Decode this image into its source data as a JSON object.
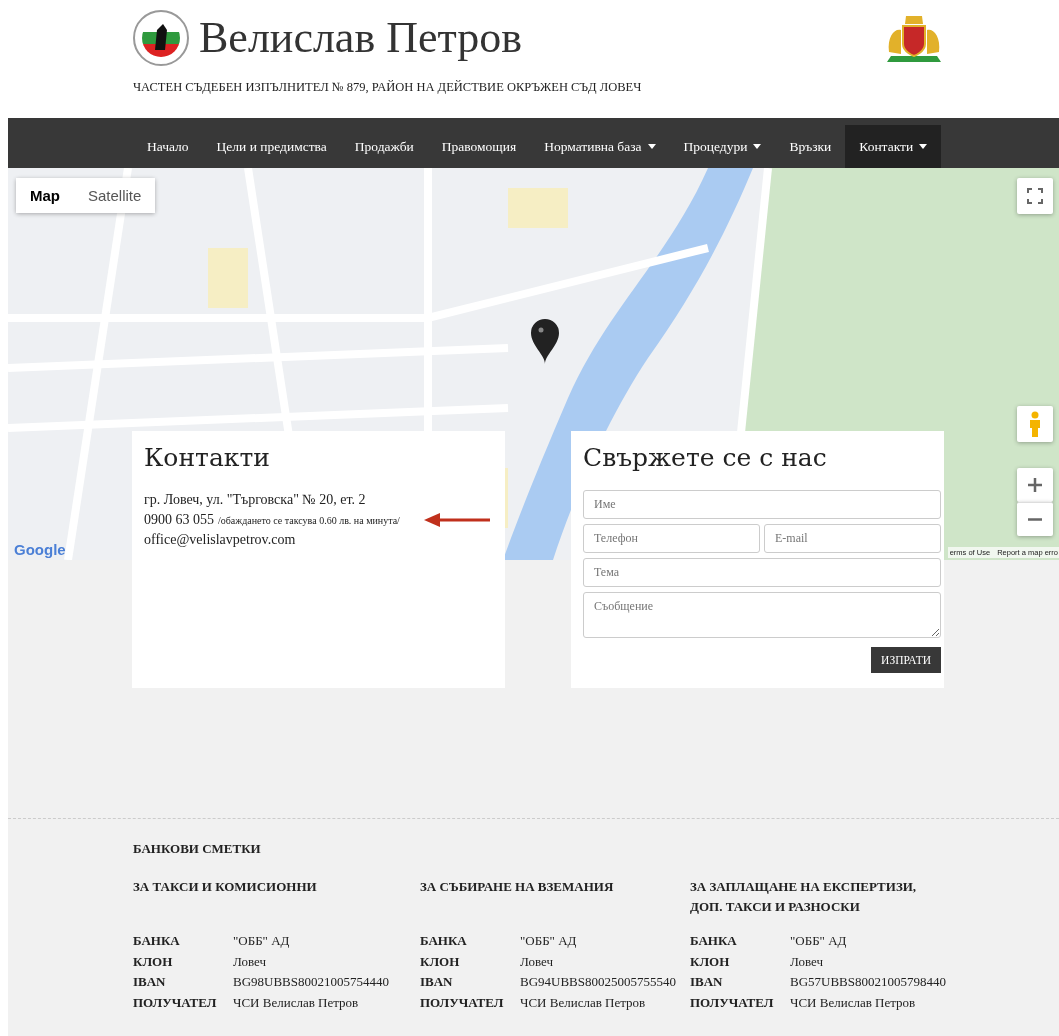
{
  "header": {
    "name": "Велислав Петров",
    "subtitle": "ЧАСТЕН СЪДЕБЕН ИЗПЪЛНИТЕЛ № 879, РАЙОН НА ДЕЙСТВИЕ ОКРЪЖЕН СЪД ЛОВЕЧ"
  },
  "nav": {
    "items": [
      {
        "label": "Начало",
        "selected": false,
        "dropdown": false
      },
      {
        "label": "Цели и предимства",
        "selected": false,
        "dropdown": false
      },
      {
        "label": "Продажби",
        "selected": false,
        "dropdown": false
      },
      {
        "label": "Правомощия",
        "selected": false,
        "dropdown": false
      },
      {
        "label": "Нормативна база",
        "selected": false,
        "dropdown": true
      },
      {
        "label": "Процедури",
        "selected": false,
        "dropdown": true
      },
      {
        "label": "Връзки",
        "selected": false,
        "dropdown": false
      },
      {
        "label": "Контакти",
        "selected": true,
        "dropdown": true
      }
    ]
  },
  "map": {
    "view_tabs": [
      {
        "label": "Map",
        "selected": true
      },
      {
        "label": "Satellite",
        "selected": false
      }
    ],
    "attribution": "Google",
    "links": [
      "erms of Use",
      "Report a map erro"
    ]
  },
  "contacts": {
    "title": "Контакти",
    "address": "гр. Ловеч, ул. \"Търговска\" № 20, ет. 2",
    "phone": "0900 63 055",
    "phone_note": "/обаждането се таксува 0.60 лв. на минута/",
    "email": "office@velislavpetrov.com"
  },
  "contact_form": {
    "title": "Свържете се с нас",
    "fields": [
      {
        "placeholder": "Име",
        "kind": "full"
      },
      {
        "placeholder": "Телефон",
        "kind": "half"
      },
      {
        "placeholder": "E-mail",
        "kind": "half"
      },
      {
        "placeholder": "Тема",
        "kind": "full"
      },
      {
        "placeholder": "Съобщение",
        "kind": "textarea"
      }
    ],
    "submit": "ИЗПРАТИ"
  },
  "bank": {
    "title": "БАНКОВИ СМЕТКИ",
    "accounts": [
      {
        "heading": "ЗА ТАКСИ И КОМИСИОННИ",
        "rows": [
          {
            "label": "БАНКА",
            "value": "\"ОББ\" АД"
          },
          {
            "label": "КЛОН",
            "value": "Ловеч"
          },
          {
            "label": "IBAN",
            "value": "BG98UBBS80021005754440"
          },
          {
            "label": "ПОЛУЧАТЕЛ",
            "value": "ЧСИ Велислав Петров"
          }
        ]
      },
      {
        "heading": "ЗА СЪБИРАНЕ НА ВЗЕМАНИЯ",
        "rows": [
          {
            "label": "БАНКА",
            "value": "\"ОББ\" АД"
          },
          {
            "label": "КЛОН",
            "value": "Ловеч"
          },
          {
            "label": "IBAN",
            "value": "BG94UBBS80025005755540"
          },
          {
            "label": "ПОЛУЧАТЕЛ",
            "value": "ЧСИ Велислав Петров"
          }
        ]
      },
      {
        "heading": "ЗА ЗАПЛАЩАНЕ НА ЕКСПЕРТИЗИ, ДОП. ТАКСИ И РАЗНОСКИ",
        "rows": [
          {
            "label": "БАНКА",
            "value": "\"ОББ\" АД"
          },
          {
            "label": "КЛОН",
            "value": "Ловеч"
          },
          {
            "label": "IBAN",
            "value": "BG57UBBS80021005798440"
          },
          {
            "label": "ПОЛУЧАТЕЛ",
            "value": "ЧСИ Велислав Петров"
          }
        ]
      }
    ]
  }
}
